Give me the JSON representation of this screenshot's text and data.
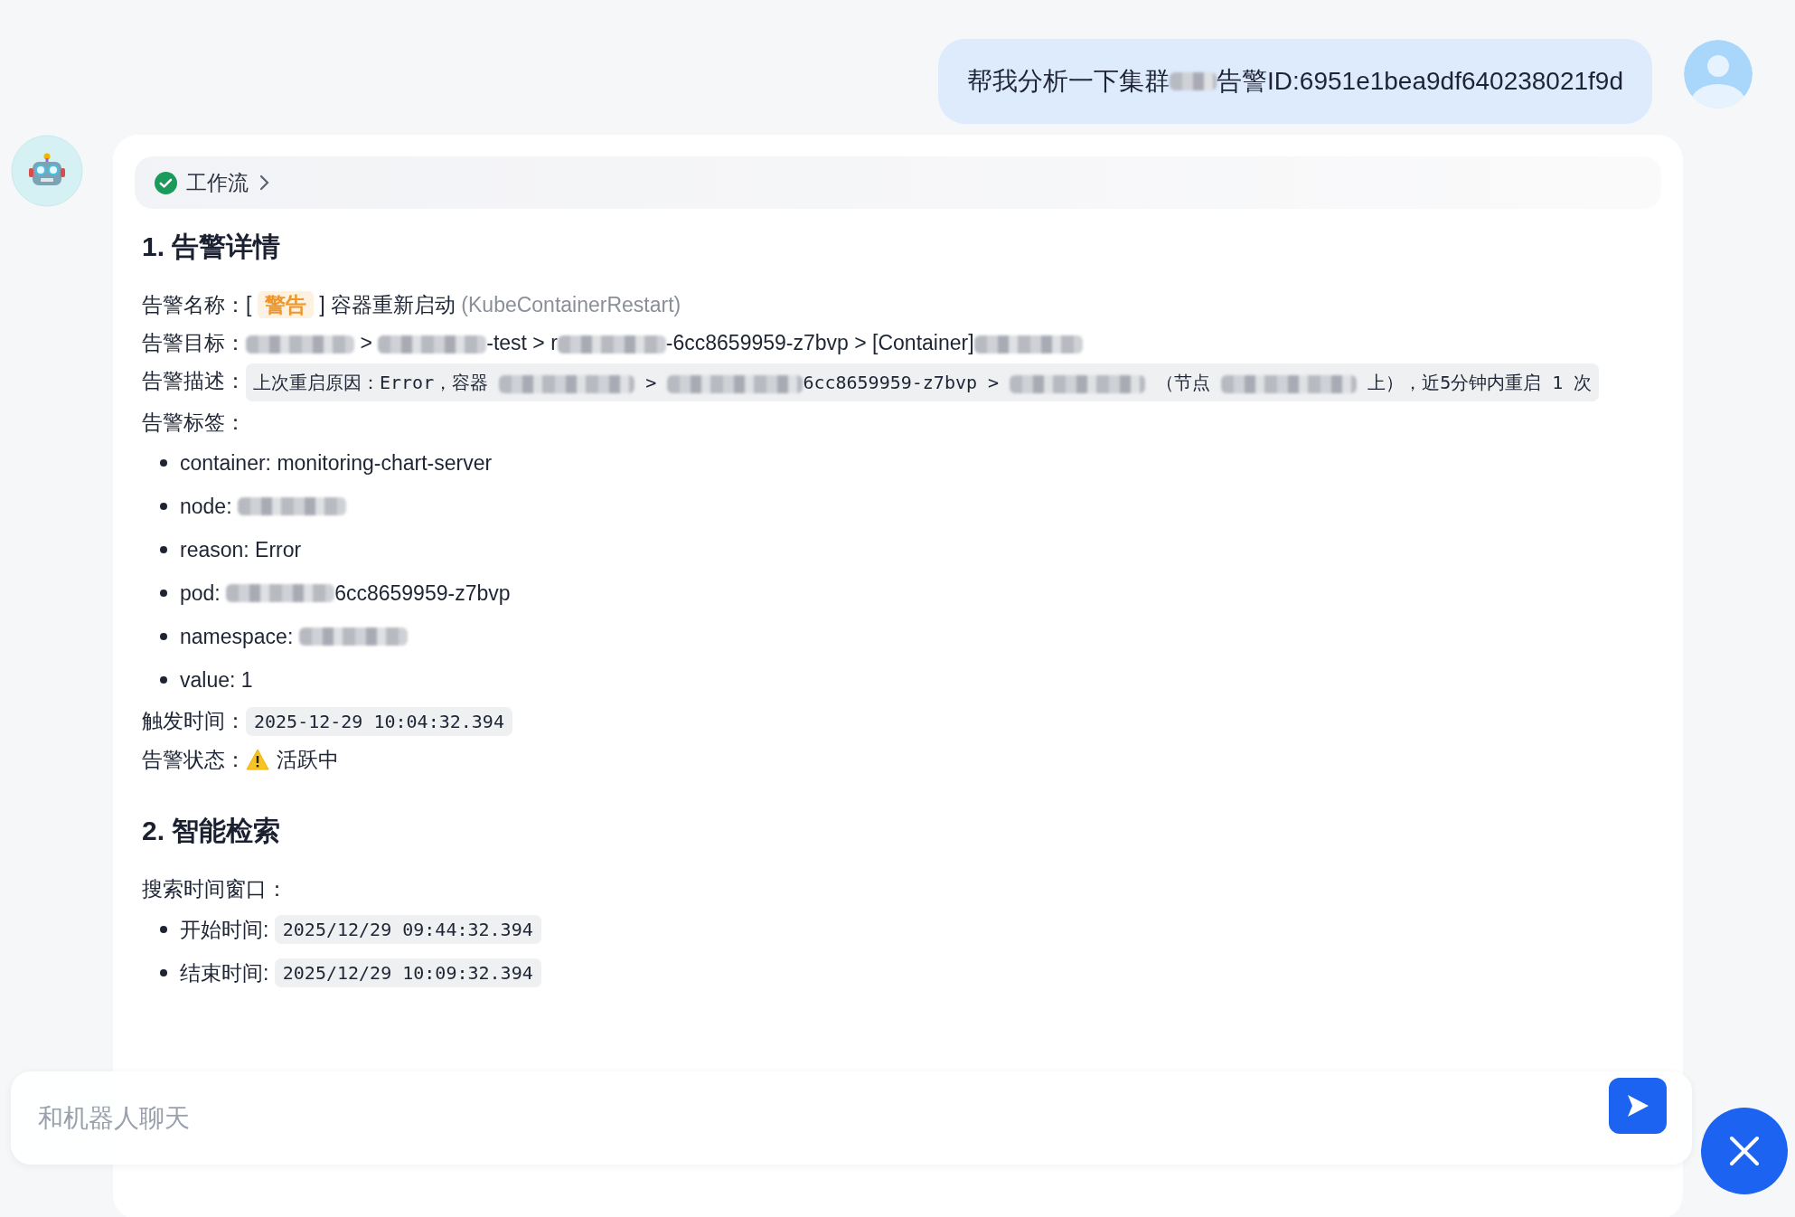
{
  "user_message": {
    "segments": [
      {
        "kind": "text",
        "text": "帮我分析一下集群"
      },
      {
        "kind": "redacted"
      },
      {
        "kind": "text",
        "text": "告警ID:6951e1bea9df640238021f9d"
      }
    ]
  },
  "workflow": {
    "label": "工作流"
  },
  "sections": [
    {
      "heading": "1. 告警详情",
      "blocks": [
        {
          "kind": "field",
          "label": "告警名称：",
          "segments": [
            {
              "kind": "text",
              "text": "[ "
            },
            {
              "kind": "tag",
              "text": "警告"
            },
            {
              "kind": "text",
              "text": " ] 容器重新启动 "
            },
            {
              "kind": "muted",
              "text": "(KubeContainerRestart)"
            }
          ]
        },
        {
          "kind": "field",
          "label": "告警目标：",
          "segments": [
            {
              "kind": "redacted"
            },
            {
              "kind": "text",
              "text": " > "
            },
            {
              "kind": "redacted"
            },
            {
              "kind": "text",
              "text": "-test > r"
            },
            {
              "kind": "redacted"
            },
            {
              "kind": "text",
              "text": "-6cc8659959-z7bvp > [Container]"
            },
            {
              "kind": "redacted"
            }
          ]
        },
        {
          "kind": "codefield",
          "label": "告警描述：",
          "segments": [
            {
              "kind": "text",
              "text": "上次重启原因：Error，容器 "
            },
            {
              "kind": "redacted"
            },
            {
              "kind": "text",
              "text": " > "
            },
            {
              "kind": "redacted"
            },
            {
              "kind": "text",
              "text": "6cc8659959-z7bvp > "
            },
            {
              "kind": "redacted"
            },
            {
              "kind": "text",
              "text": " （节点 "
            },
            {
              "kind": "redacted"
            },
            {
              "kind": "text",
              "text": " 上），近5分钟内重启 1 次"
            }
          ]
        },
        {
          "kind": "caption",
          "text": "告警标签："
        },
        {
          "kind": "list",
          "items": [
            {
              "segments": [
                {
                  "kind": "text",
                  "text": "container: monitoring-chart-server"
                }
              ]
            },
            {
              "segments": [
                {
                  "kind": "text",
                  "text": "node: "
                },
                {
                  "kind": "redacted"
                }
              ]
            },
            {
              "segments": [
                {
                  "kind": "text",
                  "text": "reason: Error"
                }
              ]
            },
            {
              "segments": [
                {
                  "kind": "text",
                  "text": "pod: "
                },
                {
                  "kind": "redacted"
                },
                {
                  "kind": "text",
                  "text": "6cc8659959-z7bvp"
                }
              ]
            },
            {
              "segments": [
                {
                  "kind": "text",
                  "text": "namespace: "
                },
                {
                  "kind": "redacted"
                }
              ]
            },
            {
              "segments": [
                {
                  "kind": "text",
                  "text": "value: 1"
                }
              ]
            }
          ]
        },
        {
          "kind": "field",
          "label": "触发时间：",
          "segments": [
            {
              "kind": "code",
              "text": "2025-12-29 10:04:32.394"
            }
          ]
        },
        {
          "kind": "field",
          "label": "告警状态：",
          "segments": [
            {
              "kind": "status",
              "text": "活跃中"
            }
          ]
        }
      ]
    },
    {
      "heading": "2. 智能检索",
      "blocks": [
        {
          "kind": "caption",
          "text": "搜索时间窗口："
        },
        {
          "kind": "list",
          "items": [
            {
              "segments": [
                {
                  "kind": "text",
                  "text": "开始时间: "
                },
                {
                  "kind": "code",
                  "text": "2025/12/29 09:44:32.394"
                }
              ]
            },
            {
              "segments": [
                {
                  "kind": "text",
                  "text": "结束时间: "
                },
                {
                  "kind": "code",
                  "text": "2025/12/29 10:09:32.394"
                }
              ]
            }
          ]
        }
      ]
    }
  ],
  "input": {
    "placeholder": "和机器人聊天"
  }
}
